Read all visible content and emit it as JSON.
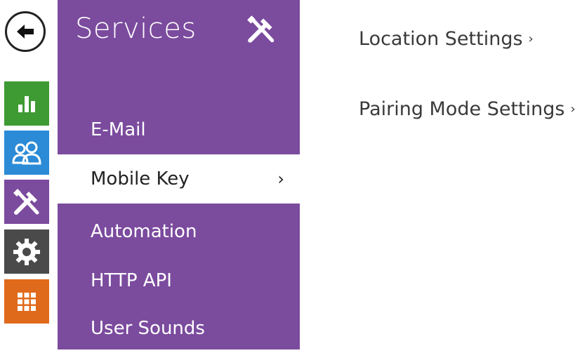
{
  "rail": {
    "back_icon": "arrow-left-icon",
    "items": [
      {
        "icon": "bar-chart-icon",
        "color": "#3e9a32"
      },
      {
        "icon": "users-icon",
        "color": "#2b8bd6"
      },
      {
        "icon": "tools-icon",
        "color": "#7b4b9e"
      },
      {
        "icon": "gear-icon",
        "color": "#4a4a4a"
      },
      {
        "icon": "grid-icon",
        "color": "#e06a1b"
      }
    ]
  },
  "panel": {
    "title": "Services",
    "title_icon": "tools-icon",
    "color": "#7b4b9e",
    "items": [
      {
        "label": "E-Mail"
      },
      {
        "label": "Mobile Key",
        "active": true,
        "chevron": "›"
      },
      {
        "label": "Automation"
      },
      {
        "label": "HTTP API"
      },
      {
        "label": "User Sounds"
      }
    ]
  },
  "content": {
    "links": [
      {
        "label": "Location Settings",
        "chevron": "›"
      },
      {
        "label": "Pairing Mode Settings",
        "chevron": "›"
      }
    ]
  }
}
